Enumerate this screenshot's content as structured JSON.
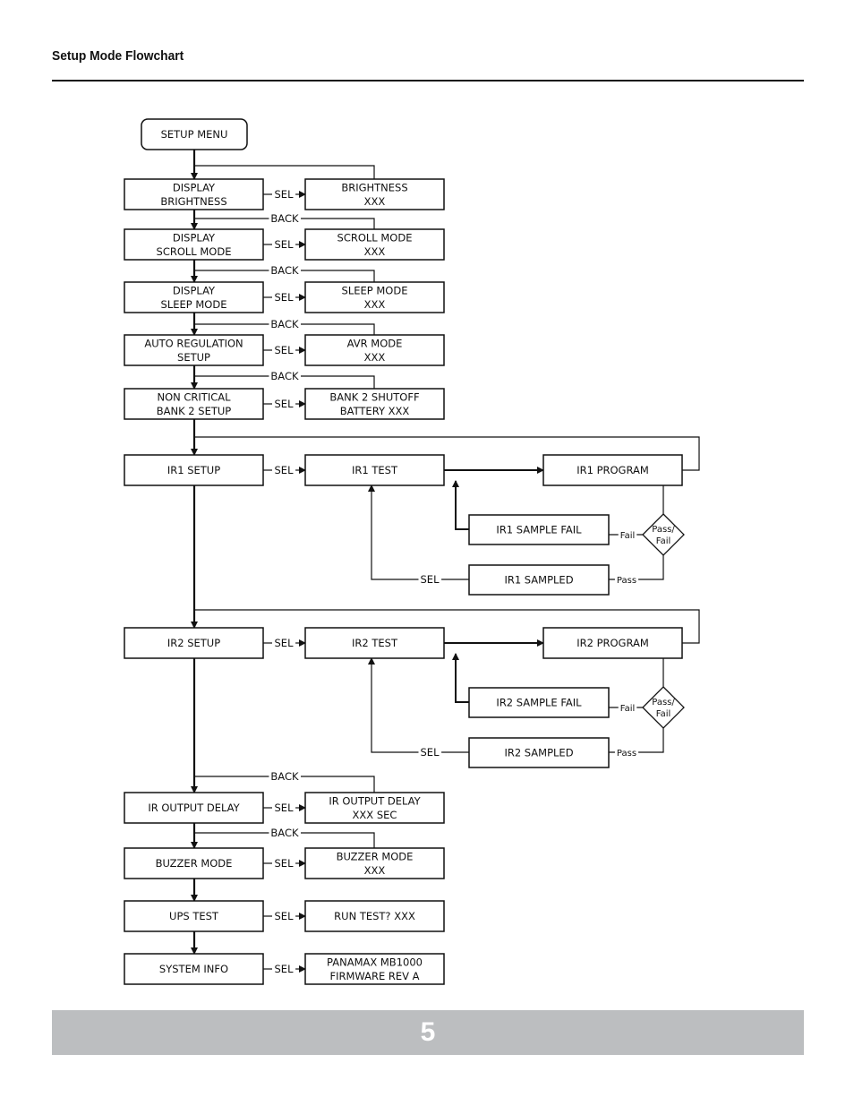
{
  "header": {
    "title": "Setup Mode Flowchart"
  },
  "footer": {
    "page_number": "5",
    "bar_color": "#bcbec0"
  },
  "flowchart": {
    "nodes": {
      "setup_menu": [
        "SETUP MENU"
      ],
      "display_brightness": [
        "DISPLAY",
        "BRIGHTNESS"
      ],
      "brightness_xxx": [
        "BRIGHTNESS",
        "XXX"
      ],
      "display_scroll": [
        "DISPLAY",
        "SCROLL MODE"
      ],
      "scroll_xxx": [
        "SCROLL MODE",
        "XXX"
      ],
      "display_sleep": [
        "DISPLAY",
        "SLEEP MODE"
      ],
      "sleep_xxx": [
        "SLEEP MODE",
        "XXX"
      ],
      "auto_reg": [
        "AUTO REGULATION",
        "SETUP"
      ],
      "avr_xxx": [
        "AVR MODE",
        "XXX"
      ],
      "bank2": [
        "NON CRITICAL",
        "BANK 2 SETUP"
      ],
      "bank2_xxx": [
        "BANK 2 SHUTOFF",
        "BATTERY XXX"
      ],
      "ir1_setup": [
        "IR1 SETUP"
      ],
      "ir1_test": [
        "IR1 TEST"
      ],
      "ir1_program": [
        "IR1 PROGRAM"
      ],
      "ir1_fail": [
        "IR1 SAMPLE FAIL"
      ],
      "ir1_sampled": [
        "IR1 SAMPLED"
      ],
      "ir1_decision": [
        "Pass/",
        "Fail"
      ],
      "ir2_setup": [
        "IR2 SETUP"
      ],
      "ir2_test": [
        "IR2 TEST"
      ],
      "ir2_program": [
        "IR2 PROGRAM"
      ],
      "ir2_fail": [
        "IR2 SAMPLE FAIL"
      ],
      "ir2_sampled": [
        "IR2 SAMPLED"
      ],
      "ir2_decision": [
        "Pass/",
        "Fail"
      ],
      "ir_delay": [
        "IR OUTPUT DELAY"
      ],
      "ir_delay_xxx": [
        "IR OUTPUT DELAY",
        "XXX SEC"
      ],
      "buzzer": [
        "BUZZER MODE"
      ],
      "buzzer_xxx": [
        "BUZZER MODE",
        "XXX"
      ],
      "ups_test": [
        "UPS TEST"
      ],
      "run_test": [
        "RUN TEST? XXX"
      ],
      "system_info": [
        "SYSTEM INFO"
      ],
      "firmware": [
        "PANAMAX MB1000",
        "FIRMWARE REV A"
      ]
    },
    "labels": {
      "sel": "SEL",
      "back": "BACK",
      "pass": "Pass",
      "fail": "Fail"
    }
  }
}
